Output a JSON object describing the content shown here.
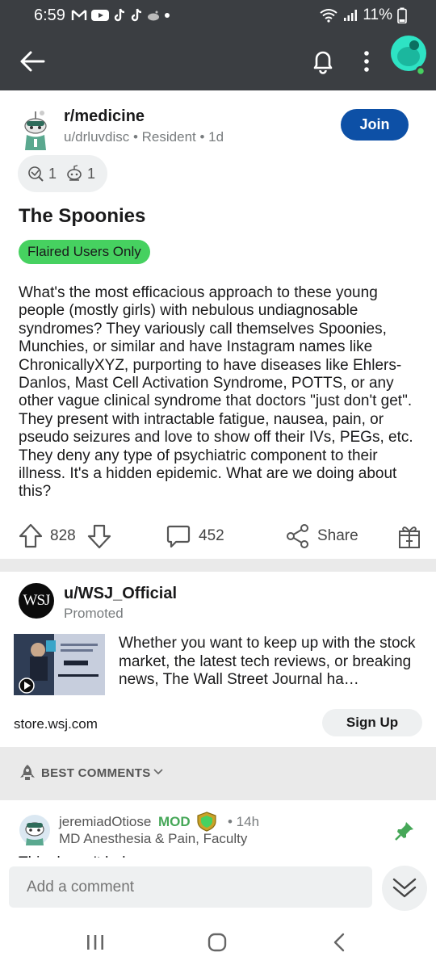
{
  "status_bar": {
    "time": "6:59",
    "battery": "11%",
    "icons": [
      "gmail-icon",
      "youtube-icon",
      "tiktok-icon",
      "tiktok-icon",
      "reddit-icon",
      "dot-icon"
    ]
  },
  "app_bar": {
    "back_icon": "back-arrow-icon",
    "bell_icon": "bell-icon",
    "more_icon": "more-vertical-icon",
    "avatar_icon": "user-avatar"
  },
  "post": {
    "subreddit": "r/medicine",
    "meta": "u/drluvdisc • Resident • 1d",
    "join_label": "Join",
    "awards": [
      {
        "icon": "award-icon",
        "count": "1"
      },
      {
        "icon": "award-icon",
        "count": "1"
      }
    ],
    "title": "The Spoonies",
    "flair": "Flaired Users Only",
    "body": "What's the most efficacious approach to these young people (mostly girls) with nebulous undiagnosable syndromes? They variously call themselves Spoonies, Munchies, or similar and have Instagram names like ChronicallyXYZ, purporting to have diseases like Ehlers-Danlos, Mast Cell Activation Syndrome, POTTS, or any other vague clinical syndrome that doctors \"just don't get\". They present with intractable fatigue, nausea, pain, or pseudo seizures and love to show off their IVs, PEGs, etc. They deny any type of psychiatric component to their illness. It's a hidden epidemic. What are we doing about this?",
    "score": "828",
    "comments": "452",
    "share_label": "Share"
  },
  "ad": {
    "avatar_text": "WSJ",
    "user": "u/WSJ_Official",
    "promoted_label": "Promoted",
    "text": "Whether you want to keep up with the stock market, the latest tech reviews, or breaking news, The Wall Street Journal ha…",
    "domain": "store.wsj.com",
    "cta_label": "Sign Up"
  },
  "comments_sort": {
    "label": "BEST COMMENTS"
  },
  "comment": {
    "author": "jeremiadOtiose",
    "mod_label": "MOD",
    "time": "• 14h",
    "flair": "MD Anesthesia & Pain, Faculty",
    "text_partial": "This doesn't belong … "
  },
  "add_comment": {
    "placeholder": "Add a comment"
  },
  "colors": {
    "app_bar": "#3b3e42",
    "join_button": "#0d50a6",
    "flair": "#46d160",
    "mod": "#46a758",
    "pin": "#46a758"
  }
}
